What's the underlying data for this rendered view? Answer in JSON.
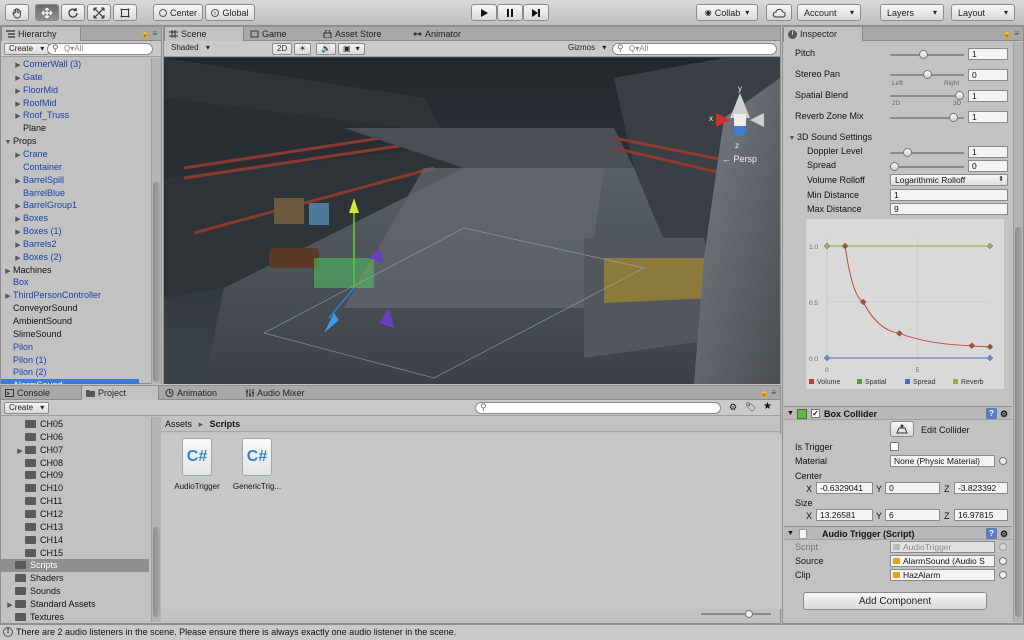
{
  "toolbar": {
    "pivot": "Center",
    "space": "Global",
    "collab": "Collab",
    "account": "Account",
    "layers": "Layers",
    "layout": "Layout"
  },
  "hierarchy": {
    "tab": "Hierarchy",
    "create": "Create",
    "search_placeholder": "Q▾All",
    "items": [
      {
        "label": "CornerWall (3)",
        "indent": 2,
        "arrow": true,
        "prefab": true
      },
      {
        "label": "Gate",
        "indent": 2,
        "arrow": true,
        "prefab": true
      },
      {
        "label": "FloorMid",
        "indent": 2,
        "arrow": true,
        "prefab": true
      },
      {
        "label": "RoofMid",
        "indent": 2,
        "arrow": true,
        "prefab": true
      },
      {
        "label": "Roof_Truss",
        "indent": 2,
        "arrow": true,
        "prefab": true
      },
      {
        "label": "Plane",
        "indent": 2,
        "arrow": false,
        "prefab": false
      },
      {
        "label": "Props",
        "indent": 1,
        "arrow": true,
        "open": true,
        "prefab": false
      },
      {
        "label": "Crane",
        "indent": 2,
        "arrow": true,
        "prefab": true
      },
      {
        "label": "Container",
        "indent": 2,
        "arrow": false,
        "prefab": true
      },
      {
        "label": "BarrelSpill",
        "indent": 2,
        "arrow": true,
        "prefab": true
      },
      {
        "label": "BarrelBlue",
        "indent": 2,
        "arrow": false,
        "prefab": true
      },
      {
        "label": "BarrelGroup1",
        "indent": 2,
        "arrow": true,
        "prefab": true
      },
      {
        "label": "Boxes",
        "indent": 2,
        "arrow": true,
        "prefab": true
      },
      {
        "label": "Boxes (1)",
        "indent": 2,
        "arrow": true,
        "prefab": true
      },
      {
        "label": "Barrels2",
        "indent": 2,
        "arrow": true,
        "prefab": true
      },
      {
        "label": "Boxes (2)",
        "indent": 2,
        "arrow": true,
        "prefab": true
      },
      {
        "label": "Machines",
        "indent": 1,
        "arrow": true,
        "prefab": false
      },
      {
        "label": "Box",
        "indent": 1,
        "arrow": false,
        "prefab": true
      },
      {
        "label": "ThirdPersonController",
        "indent": 1,
        "arrow": true,
        "prefab": true
      },
      {
        "label": "ConveyorSound",
        "indent": 1,
        "arrow": false,
        "prefab": false
      },
      {
        "label": "AmbientSound",
        "indent": 1,
        "arrow": false,
        "prefab": false
      },
      {
        "label": "SlimeSound",
        "indent": 1,
        "arrow": false,
        "prefab": false
      },
      {
        "label": "Pilon",
        "indent": 1,
        "arrow": false,
        "prefab": true
      },
      {
        "label": "Pilon (1)",
        "indent": 1,
        "arrow": false,
        "prefab": true
      },
      {
        "label": "Pilon (2)",
        "indent": 1,
        "arrow": false,
        "prefab": true
      },
      {
        "label": "AlarmSound",
        "indent": 1,
        "arrow": false,
        "prefab": false,
        "selected": true
      }
    ]
  },
  "scene": {
    "tabs": [
      "Scene",
      "Game",
      "Asset Store",
      "Animator"
    ],
    "shading": "Shaded",
    "mode_2d": "2D",
    "gizmos": "Gizmos",
    "search_placeholder": "Q▾All",
    "persp": "← Persp",
    "axis_x": "x",
    "axis_y": "y",
    "axis_z": "z"
  },
  "project": {
    "tabs": [
      "Console",
      "Project",
      "Animation",
      "Audio Mixer"
    ],
    "create": "Create",
    "breadcrumb_root": "Assets",
    "breadcrumb_current": "Scripts",
    "folders": [
      {
        "label": "CH05",
        "arrow": false
      },
      {
        "label": "CH06",
        "arrow": false
      },
      {
        "label": "CH07",
        "arrow": true
      },
      {
        "label": "CH08",
        "arrow": false
      },
      {
        "label": "CH09",
        "arrow": false
      },
      {
        "label": "CH10",
        "arrow": false
      },
      {
        "label": "CH11",
        "arrow": false
      },
      {
        "label": "CH12",
        "arrow": false
      },
      {
        "label": "CH13",
        "arrow": false
      },
      {
        "label": "CH14",
        "arrow": false
      },
      {
        "label": "CH15",
        "arrow": false
      },
      {
        "label": "Scripts",
        "arrow": false,
        "selected": true
      },
      {
        "label": "Shaders",
        "arrow": false
      },
      {
        "label": "Sounds",
        "arrow": false
      },
      {
        "label": "Standard Assets",
        "arrow": true
      },
      {
        "label": "Textures",
        "arrow": false
      }
    ],
    "assets": [
      {
        "label": "AudioTrigger",
        "glyph": "C#"
      },
      {
        "label": "GenericTrig...",
        "glyph": "C#"
      }
    ]
  },
  "inspector": {
    "tab": "Inspector",
    "pitch_label": "Pitch",
    "pitch": "1",
    "pitch_level": 0.45,
    "stereo_label": "Stereo Pan",
    "stereo": "0",
    "stereo_level": 0.5,
    "stereo_left": "Left",
    "stereo_right": "Right",
    "spatial_label": "Spatial Blend",
    "spatial": "1",
    "spatial_level": 1.0,
    "spatial_2d": "2D",
    "spatial_3d": "3D",
    "reverb_label": "Reverb Zone Mix",
    "reverb": "1",
    "reverb_level": 0.91,
    "sound3d_label": "3D Sound Settings",
    "doppler_label": "Doppler Level",
    "doppler": "1",
    "doppler_level": 0.2,
    "spread_label": "Spread",
    "spread": "0",
    "spread_level": 0.0,
    "rolloff_label": "Volume Rolloff",
    "rolloff": "Logarithmic Rolloff",
    "mindist_label": "Min Distance",
    "mindist": "1",
    "maxdist_label": "Max Distance",
    "maxdist": "9",
    "box_collider": {
      "title": "Box Collider",
      "edit": "Edit Collider",
      "trigger_label": "Is Trigger",
      "material_label": "Material",
      "material": "None (Physic Material)",
      "center_label": "Center",
      "cx": "-0.6329041",
      "cy": "0",
      "cz": "-3.823392",
      "size_label": "Size",
      "sx": "13.26581",
      "sy": "6",
      "sz": "16.97815",
      "x": "X",
      "y": "Y",
      "z": "Z"
    },
    "audio_trigger": {
      "title": "Audio Trigger (Script)",
      "script_label": "Script",
      "script": "AudioTrigger",
      "source_label": "Source",
      "source": "AlarmSound (Audio S",
      "clip_label": "Clip",
      "clip": "HazAlarm"
    },
    "add_component": "Add Component"
  },
  "chart_data": {
    "type": "line",
    "ylim": [
      0,
      1
    ],
    "yticks": [
      "1.0",
      "0.5",
      "0.0"
    ],
    "xticks": [
      "0",
      "5"
    ],
    "series": [
      {
        "name": "Volume",
        "color": "#c0392b",
        "x": [
          0,
          1,
          2,
          4,
          8,
          9
        ],
        "y": [
          1.0,
          1.0,
          0.5,
          0.22,
          0.11,
          0.1
        ]
      },
      {
        "name": "Spatial",
        "color": "#5a9b3b",
        "x": [
          0,
          9
        ],
        "y": [
          1.0,
          1.0
        ]
      },
      {
        "name": "Spread",
        "color": "#3e6fc4",
        "x": [
          0,
          9
        ],
        "y": [
          0.0,
          0.0
        ]
      },
      {
        "name": "Reverb",
        "color": "#98a83a",
        "x": [
          0,
          9
        ],
        "y": [
          1.0,
          1.0
        ]
      }
    ],
    "legend": [
      "Volume",
      "Spatial",
      "Spread",
      "Reverb"
    ],
    "legend_colors": [
      "#c0392b",
      "#5a9b3b",
      "#3e6fc4",
      "#98a83a"
    ]
  },
  "status": "There are 2 audio listeners in the scene. Please ensure there is always exactly one audio listener in the scene."
}
